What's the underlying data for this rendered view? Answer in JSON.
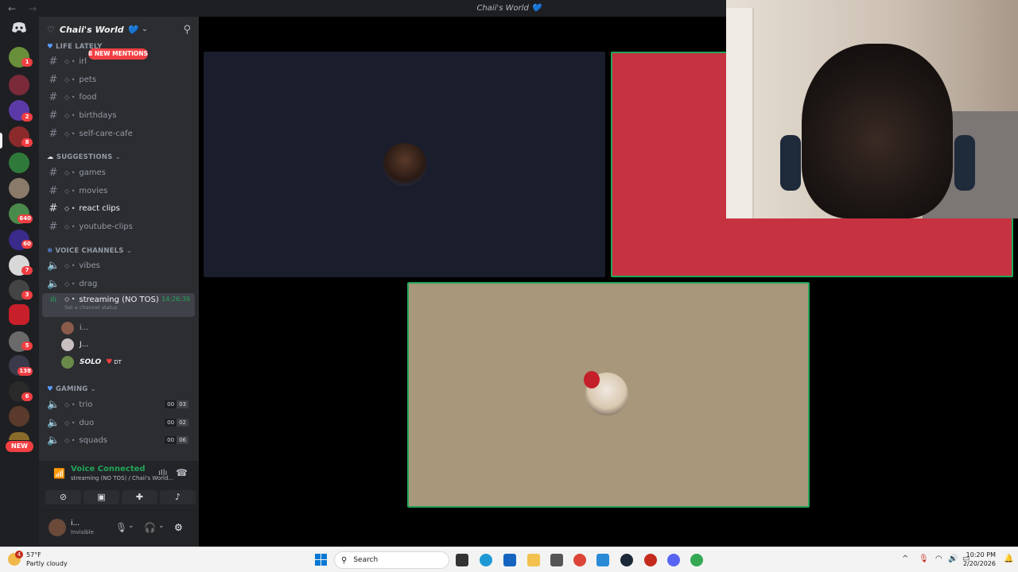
{
  "window": {
    "title": "Chaii's World 💙"
  },
  "server": {
    "name": "Chaii's World 💙",
    "mentions_label": "8 NEW MENTIONS"
  },
  "rail": {
    "badges": [
      "1",
      "2",
      "8",
      "640",
      "60",
      "7",
      "3",
      "5",
      "138",
      "6"
    ],
    "new_label": "NEW"
  },
  "categories": {
    "life": "LIFE LATELY",
    "suggestions": "SUGGESTIONS",
    "voice": "VOICE CHANNELS",
    "gaming": "GAMING"
  },
  "channels": {
    "irl": "irl",
    "pets": "pets",
    "food": "food",
    "birthdays": "birthdays",
    "selfcare": "self-care-cafe",
    "games": "games",
    "movies": "movies",
    "react": "react clips",
    "youtube": "youtube-clips",
    "vibes": "vibes",
    "drag": "drag",
    "streaming": "streaming (NO TOS)",
    "streaming_time": "14:26:39",
    "streaming_status": "Set a channel status",
    "trio": "trio",
    "duo": "duo",
    "squads": "squads"
  },
  "gaming_counts": {
    "trio": [
      "00",
      "03"
    ],
    "duo": [
      "00",
      "02"
    ],
    "squads": [
      "00",
      "06"
    ]
  },
  "voice_users": [
    "i...",
    "J...",
    "SOLO",
    "DT"
  ],
  "voice_panel": {
    "status": "Voice Connected",
    "subtitle": "streaming (NO TOS) / Chaii's World..."
  },
  "user": {
    "name": "i...",
    "status": "Invisible"
  },
  "taskbar": {
    "weather_badge": "4",
    "weather_temp": "57°F",
    "weather_desc": "Partly cloudy",
    "search": "Search",
    "time": "10:20 PM",
    "date": "2/20/2026"
  },
  "colors": {
    "accent_green": "#23a55a",
    "mention_red": "#f23f43",
    "tile_red": "#c73241",
    "tile_tan": "#a8977a"
  }
}
